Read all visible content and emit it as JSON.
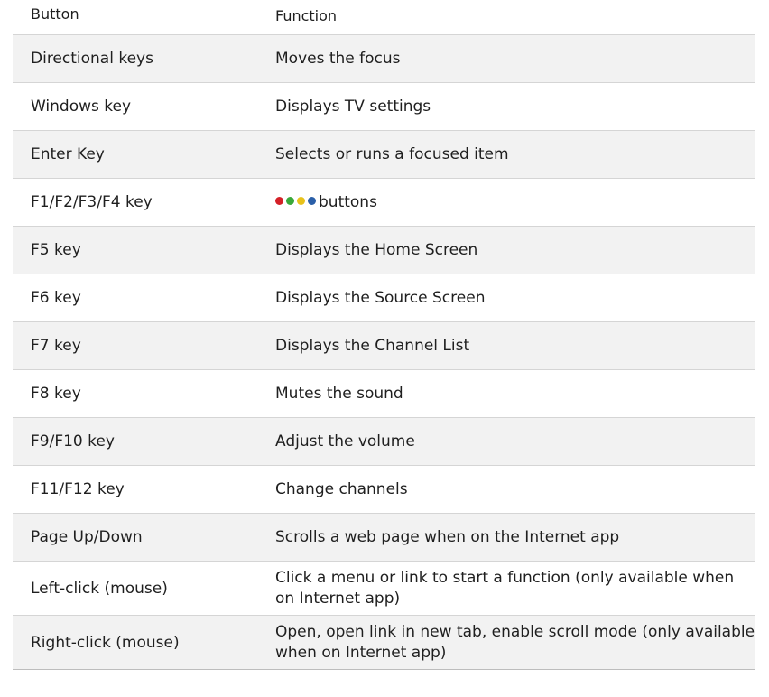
{
  "header": {
    "col1": "Button",
    "col2": "Function"
  },
  "dot_colors": {
    "red": "#d42027",
    "green": "#3aa83a",
    "yellow": "#e8c21b",
    "blue": "#2a5fa8"
  },
  "rows": [
    {
      "button": "Directional keys",
      "function": "Moves the focus"
    },
    {
      "button": "Windows key",
      "function": "Displays TV settings"
    },
    {
      "button": "Enter Key",
      "function": "Selects or runs a focused item"
    },
    {
      "button": "F1/F2/F3/F4 key",
      "function": "buttons"
    },
    {
      "button": "F5 key",
      "function": "Displays the Home Screen"
    },
    {
      "button": "F6 key",
      "function": "Displays the Source Screen"
    },
    {
      "button": "F7 key",
      "function": "Displays the Channel List"
    },
    {
      "button": "F8 key",
      "function": "Mutes the sound"
    },
    {
      "button": "F9/F10 key",
      "function": "Adjust the volume"
    },
    {
      "button": "F11/F12 key",
      "function": "Change channels"
    },
    {
      "button": "Page Up/Down",
      "function": "Scrolls a web page when on the Internet app"
    },
    {
      "button": "Left-click (mouse)",
      "function": "Click a menu or link to start a function (only available when on Internet app)"
    },
    {
      "button": "Right-click (mouse)",
      "function": "Open, open link in new tab, enable scroll mode (only available when on Internet app)"
    }
  ]
}
